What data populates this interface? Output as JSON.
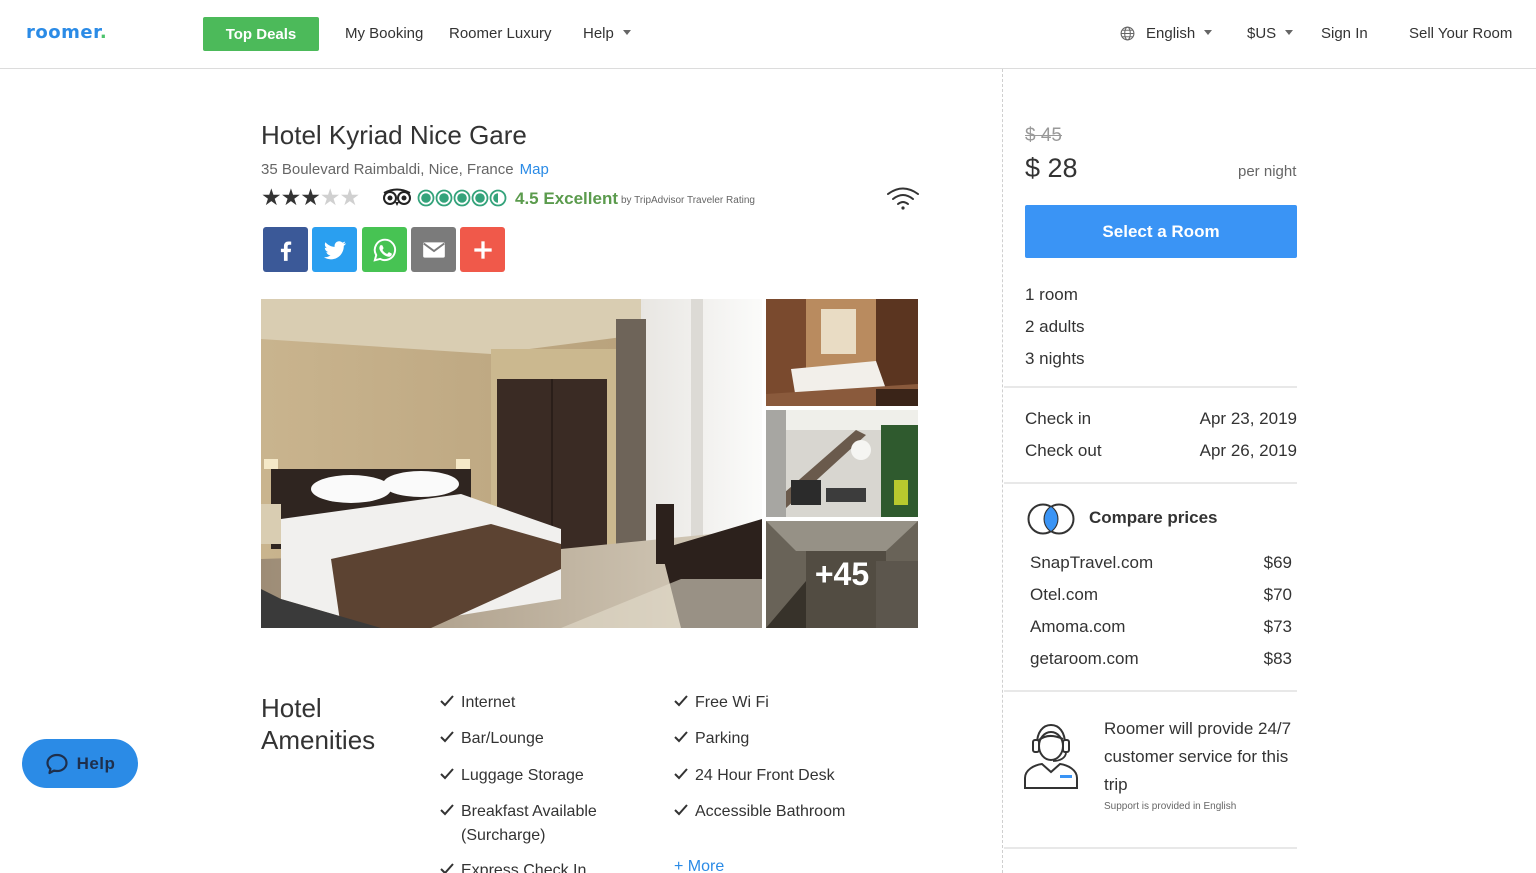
{
  "header": {
    "logo": "roomer",
    "logo_dot": ".",
    "top_deals": "Top Deals",
    "my_booking": "My Booking",
    "roomer_luxury": "Roomer Luxury",
    "help": "Help",
    "language": "English",
    "currency": "$US",
    "sign_in": "Sign In",
    "sell_room": "Sell Your Room"
  },
  "hotel": {
    "name": "Hotel Kyriad Nice Gare",
    "address": "35 Boulevard Raimbaldi, Nice, France",
    "map_link": "Map",
    "stars": 3,
    "stars_max": 5,
    "tripadvisor_score": 4.5,
    "rating_label": "4.5 Excellent",
    "rating_sub": "by TripAdvisor Traveler Rating",
    "more_photos": "+45"
  },
  "share": [
    {
      "name": "facebook",
      "color": "#3b5998"
    },
    {
      "name": "twitter",
      "color": "#2a9ff0"
    },
    {
      "name": "whatsapp",
      "color": "#47c353"
    },
    {
      "name": "email",
      "color": "#7b7b7b"
    },
    {
      "name": "more",
      "color": "#f0594a"
    }
  ],
  "amenities": {
    "title_line1": "Hotel",
    "title_line2": "Amenities",
    "col1": [
      "Internet",
      "Bar/Lounge",
      "Luggage Storage",
      "Breakfast Available",
      "(Surcharge)",
      "Express Check In"
    ],
    "col2": [
      "Free Wi Fi",
      "Parking",
      "24 Hour Front Desk",
      "Accessible Bathroom"
    ],
    "more": "+ More"
  },
  "help_fab": "Help",
  "booking": {
    "old_price": "$ 45",
    "new_price": "$ 28",
    "per_night": "per night",
    "select_room": "Select a Room",
    "rooms": "1 room",
    "adults": "2 adults",
    "nights": "3 nights",
    "check_in_label": "Check in",
    "check_in_date": "Apr 23, 2019",
    "check_out_label": "Check out",
    "check_out_date": "Apr 26, 2019"
  },
  "compare": {
    "title": "Compare prices",
    "sites": [
      {
        "site": "SnapTravel.com",
        "price": "$69"
      },
      {
        "site": "Otel.com",
        "price": "$70"
      },
      {
        "site": "Amoma.com",
        "price": "$73"
      },
      {
        "site": "getaroom.com",
        "price": "$83"
      }
    ]
  },
  "support": {
    "text": "Roomer will provide 24/7 customer service for this trip",
    "note": "Support is provided in English"
  },
  "colors": {
    "brand_blue": "#2b8be6",
    "deals_green": "#4cba5a",
    "select_blue": "#3a94f5",
    "rating_green": "#5b9b4d"
  }
}
